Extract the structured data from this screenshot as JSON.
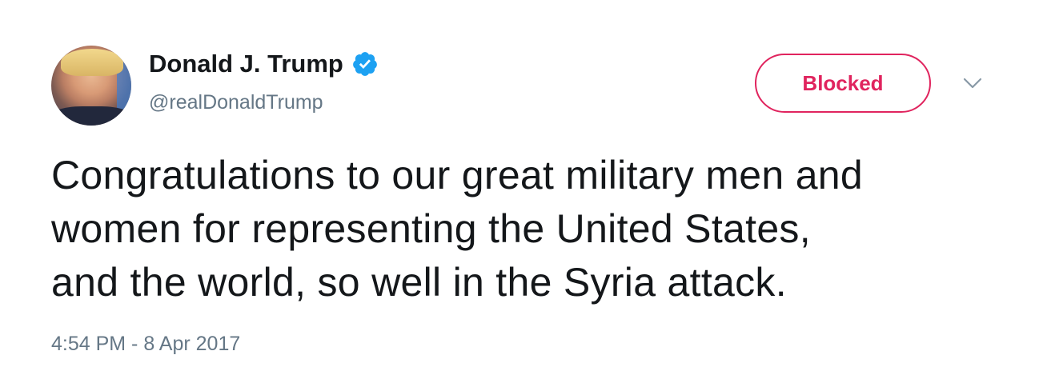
{
  "author": {
    "name": "Donald J. Trump",
    "handle": "@realDonaldTrump",
    "verified": true
  },
  "actions": {
    "blocked_label": "Blocked",
    "menu_icon": "chevron-down-icon"
  },
  "tweet": {
    "lines": [
      "Congratulations to our great military men and",
      "women for representing the United States,",
      "and the world, so well in the Syria attack."
    ],
    "timestamp": "4:54 PM - 8 Apr 2017"
  },
  "colors": {
    "blocked_accent": "#e0245e",
    "verified_blue": "#1da1f2",
    "secondary_text": "#657786",
    "primary_text": "#14171a"
  }
}
